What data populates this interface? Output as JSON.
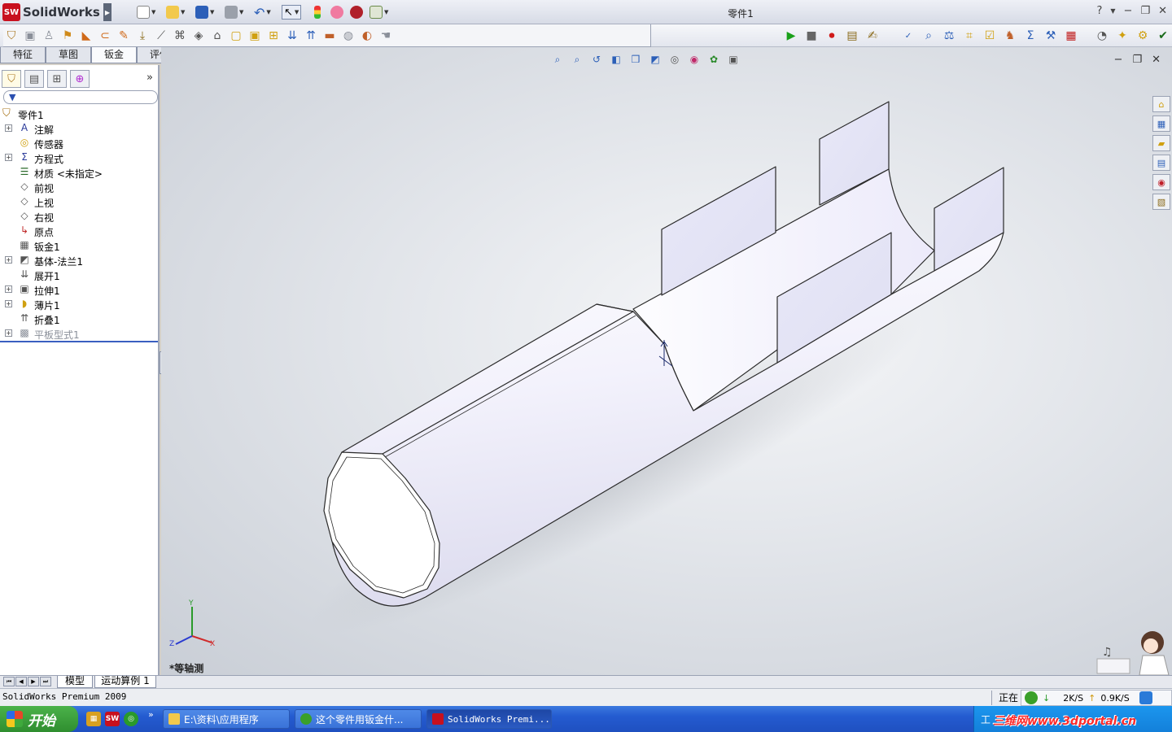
{
  "app": {
    "brand": "SolidWorks",
    "badge": "SW",
    "window_title": "零件1"
  },
  "command_tabs": [
    {
      "label": "特征"
    },
    {
      "label": "草图"
    },
    {
      "label": "钣金"
    },
    {
      "label": "评估"
    }
  ],
  "feature_tree": {
    "root": "零件1",
    "items": [
      {
        "label": "注解",
        "expandable": true,
        "icon": "annotations-icon"
      },
      {
        "label": "传感器",
        "expandable": false,
        "icon": "sensor-icon"
      },
      {
        "label": "方程式",
        "expandable": true,
        "icon": "equations-icon"
      },
      {
        "label": "材质 <未指定>",
        "expandable": false,
        "icon": "material-icon"
      },
      {
        "label": "前视",
        "expandable": false,
        "icon": "plane-icon"
      },
      {
        "label": "上视",
        "expandable": false,
        "icon": "plane-icon"
      },
      {
        "label": "右视",
        "expandable": false,
        "icon": "plane-icon"
      },
      {
        "label": "原点",
        "expandable": false,
        "icon": "origin-icon"
      },
      {
        "label": "钣金1",
        "expandable": false,
        "icon": "sheet-metal-icon"
      },
      {
        "label": "基体-法兰1",
        "expandable": true,
        "icon": "base-flange-icon"
      },
      {
        "label": "展开1",
        "expandable": false,
        "icon": "unfold-icon"
      },
      {
        "label": "拉伸1",
        "expandable": true,
        "icon": "extrude-icon"
      },
      {
        "label": "薄片1",
        "expandable": true,
        "icon": "tab-icon"
      },
      {
        "label": "折叠1",
        "expandable": false,
        "icon": "fold-icon"
      },
      {
        "label": "平板型式1",
        "expandable": true,
        "icon": "flat-pattern-icon",
        "suppressed": true
      }
    ]
  },
  "viewport": {
    "view_name": "*等轴测",
    "triad": {
      "x": "X",
      "y": "Y",
      "z": "Z"
    }
  },
  "bottom_tabs": [
    {
      "label": "模型"
    },
    {
      "label": "运动算例 1"
    }
  ],
  "status": {
    "left": "SolidWorks Premium 2009",
    "right": "正在"
  },
  "netmeter": {
    "down": "2K/S",
    "up": "0.9K/S"
  },
  "taskbar": {
    "start": "开始",
    "more": "»",
    "tasks": [
      {
        "label": "E:\\资料\\应用程序",
        "icon": "folder-icon"
      },
      {
        "label": "这个零件用钣金什...",
        "icon": "chat-icon"
      },
      {
        "label": "SolidWorks Premi...",
        "icon": "solidworks-icon"
      }
    ],
    "tray_text": "工",
    "watermark": "三维网www.3dportal.cn"
  },
  "colors": {
    "part_face": "#f2f1fc",
    "part_face_shade": "#d9d8ec",
    "part_edge": "#2a2a2a",
    "accent": "#3a5fc0",
    "brand_red": "#c8101e"
  }
}
